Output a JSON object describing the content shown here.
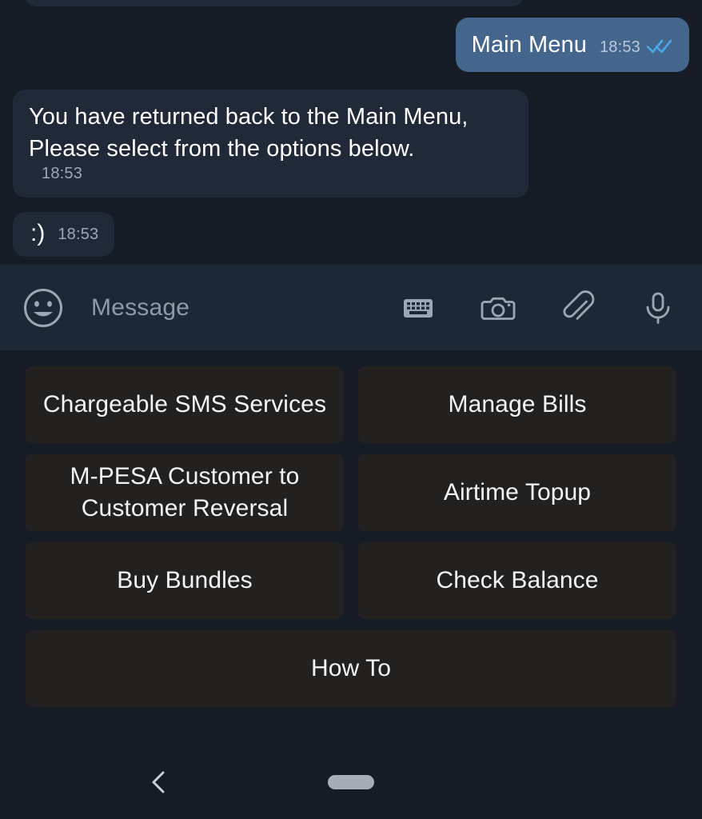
{
  "app": {
    "name": "telegram-chat",
    "theme": {
      "chat_background": "#151c26",
      "incoming_bubble": "#1f2937",
      "outgoing_bubble": "#44658c",
      "input_bar_background": "#1d2836",
      "keyboard_button_background": "#222120",
      "text_primary": "#ffffff",
      "text_muted": "#8d9aa8",
      "tick_color": "#4aa8e8",
      "nav_home_pill": "#a6adb4"
    }
  },
  "chat": {
    "messages": [
      {
        "id": "msg-partial",
        "direction": "in",
        "text": "",
        "time": "",
        "partial": true
      },
      {
        "id": "msg-main-menu",
        "direction": "out",
        "text": "Main Menu",
        "time": "18:53",
        "status_icon": "double-check-icon",
        "read": true
      },
      {
        "id": "msg-returned",
        "direction": "in",
        "text": "You have returned back to the Main Menu,\nPlease select from the options below.",
        "time": "18:53"
      },
      {
        "id": "msg-smiley",
        "direction": "in",
        "text": ":)",
        "time": "18:53"
      }
    ]
  },
  "input_bar": {
    "emoji_icon": "smiley-icon",
    "placeholder": "Message",
    "value": "",
    "actions": [
      {
        "name": "keyboard-icon",
        "label": "Keyboard"
      },
      {
        "name": "camera-icon",
        "label": "Camera"
      },
      {
        "name": "attach-icon",
        "label": "Attach"
      },
      {
        "name": "microphone-icon",
        "label": "Voice message"
      }
    ]
  },
  "keyboard": {
    "rows": [
      [
        {
          "label": "Chargeable SMS Services",
          "name": "kb-btn-chargeable-sms-services"
        },
        {
          "label": "Manage Bills",
          "name": "kb-btn-manage-bills"
        }
      ],
      [
        {
          "label": "M-PESA Customer to\nCustomer Reversal",
          "name": "kb-btn-mpesa-customer-reversal"
        },
        {
          "label": "Airtime Topup",
          "name": "kb-btn-airtime-topup"
        }
      ],
      [
        {
          "label": "Buy Bundles",
          "name": "kb-btn-buy-bundles"
        },
        {
          "label": "Check Balance",
          "name": "kb-btn-check-balance"
        }
      ],
      [
        {
          "label": "How To",
          "name": "kb-btn-how-to"
        }
      ]
    ]
  },
  "nav_bar": {
    "back_icon": "chevron-left-icon",
    "home_indicator": "home-pill-indicator"
  }
}
